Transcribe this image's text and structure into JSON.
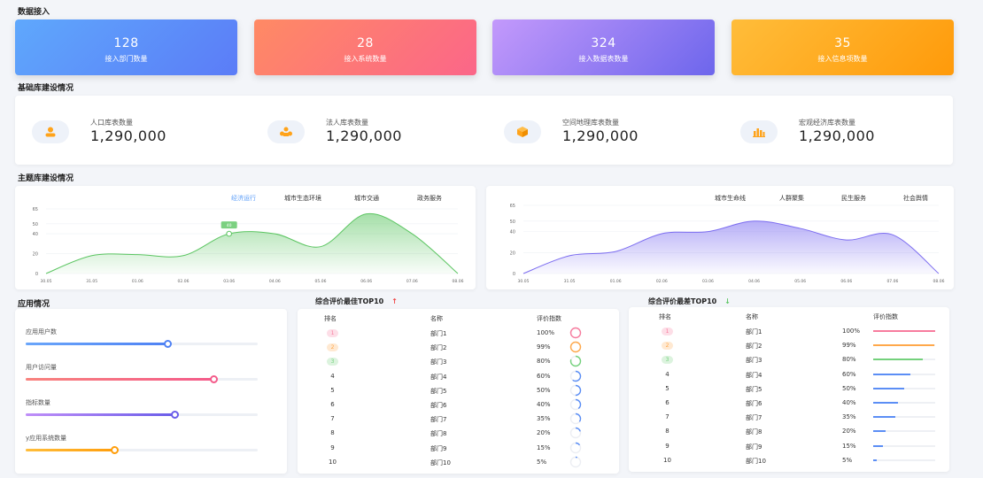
{
  "sections": {
    "data_access": "数据接入",
    "base_lib": "基础库建设情况",
    "theme_lib": "主题库建设情况",
    "app": "应用情况"
  },
  "kpis": [
    {
      "value": "128",
      "label": "接入部门数量",
      "from": "#5fa8fc",
      "to": "#5b7cf7"
    },
    {
      "value": "28",
      "label": "接入系统数量",
      "from": "#ff8a64",
      "to": "#fb6689"
    },
    {
      "value": "324",
      "label": "接入数据表数量",
      "from": "#c399fb",
      "to": "#6d66ec"
    },
    {
      "value": "35",
      "label": "接入信息项数量",
      "from": "#ffbd3a",
      "to": "#ff9a0a"
    }
  ],
  "base": [
    {
      "label": "人口库表数量",
      "value": "1,290,000",
      "icon": "person-icon"
    },
    {
      "label": "法人库表数量",
      "value": "1,290,000",
      "icon": "group-icon"
    },
    {
      "label": "空间地理库表数量",
      "value": "1,290,000",
      "icon": "cube-icon"
    },
    {
      "label": "宏观经济库表数量",
      "value": "1,290,000",
      "icon": "bar-chart-icon"
    }
  ],
  "left_tabs": [
    "经济运行",
    "城市生态环境",
    "城市交通",
    "政务服务"
  ],
  "right_tabs": [
    "城市生命线",
    "人群聚集",
    "民生服务",
    "社会舆情"
  ],
  "chart_data": [
    {
      "type": "area",
      "x": [
        "30.05",
        "31.05",
        "01.06",
        "02.06",
        "03.06",
        "04.06",
        "05.06",
        "06.06",
        "07.06",
        "08.06"
      ],
      "values": [
        0,
        18,
        19,
        18,
        40,
        40,
        27,
        60,
        40,
        0
      ],
      "ylim": [
        0,
        65
      ],
      "yticks": [
        0,
        20,
        40,
        50,
        65
      ],
      "color": "#5bc561",
      "tooltip_value": "40",
      "tooltip_index": 4
    },
    {
      "type": "area",
      "x": [
        "30.05",
        "31.05",
        "01.06",
        "02.06",
        "03.06",
        "04.06",
        "05.06",
        "06.06",
        "07.06",
        "08.06"
      ],
      "values": [
        0,
        17,
        21,
        38,
        40,
        50,
        43,
        32,
        37,
        0
      ],
      "ylim": [
        0,
        65
      ],
      "yticks": [
        0,
        20,
        40,
        50,
        65
      ],
      "color": "#7b6cf0"
    }
  ],
  "apps": [
    {
      "label": "应用用户数",
      "value": 0.61,
      "from": "#6aa6fa",
      "to": "#4f82f4",
      "knob": "#4f82f4"
    },
    {
      "label": "用户访问量",
      "value": 0.81,
      "from": "#f8837e",
      "to": "#f45b8a",
      "knob": "#f45b8a"
    },
    {
      "label": "指标数量",
      "value": 0.64,
      "from": "#c08ff8",
      "to": "#6a5de9",
      "knob": "#6a5de9"
    },
    {
      "label": "y应用系统数量",
      "value": 0.38,
      "from": "#ffbe3c",
      "to": "#ff9e0c",
      "knob": "#ff9e0c"
    }
  ],
  "best": {
    "title": "综合评价最佳TOP10",
    "arrow": "↑",
    "headers": [
      "排名",
      "名称",
      "评价指数"
    ],
    "rows": [
      {
        "rank": "1",
        "name": "部门1",
        "score": "100%",
        "pct": 1.0
      },
      {
        "rank": "2",
        "name": "部门2",
        "score": "99%",
        "pct": 0.99
      },
      {
        "rank": "3",
        "name": "部门3",
        "score": "80%",
        "pct": 0.8
      },
      {
        "rank": "4",
        "name": "部门4",
        "score": "60%",
        "pct": 0.6
      },
      {
        "rank": "5",
        "name": "部门5",
        "score": "50%",
        "pct": 0.5
      },
      {
        "rank": "6",
        "name": "部门6",
        "score": "40%",
        "pct": 0.4
      },
      {
        "rank": "7",
        "name": "部门7",
        "score": "35%",
        "pct": 0.35
      },
      {
        "rank": "8",
        "name": "部门8",
        "score": "20%",
        "pct": 0.2
      },
      {
        "rank": "9",
        "name": "部门9",
        "score": "15%",
        "pct": 0.15
      },
      {
        "rank": "10",
        "name": "部门10",
        "score": "5%",
        "pct": 0.05
      }
    ]
  },
  "worst": {
    "title": "综合评价最差TOP10",
    "arrow": "↓",
    "headers": [
      "排名",
      "名称",
      "评价指数"
    ],
    "rows": [
      {
        "rank": "1",
        "name": "部门1",
        "score": "100%",
        "pct": 1.0
      },
      {
        "rank": "2",
        "name": "部门2",
        "score": "99%",
        "pct": 0.99
      },
      {
        "rank": "3",
        "name": "部门3",
        "score": "80%",
        "pct": 0.8
      },
      {
        "rank": "4",
        "name": "部门4",
        "score": "60%",
        "pct": 0.6
      },
      {
        "rank": "5",
        "name": "部门5",
        "score": "50%",
        "pct": 0.5
      },
      {
        "rank": "6",
        "name": "部门6",
        "score": "40%",
        "pct": 0.4
      },
      {
        "rank": "7",
        "name": "部门7",
        "score": "35%",
        "pct": 0.35
      },
      {
        "rank": "8",
        "name": "部门8",
        "score": "20%",
        "pct": 0.2
      },
      {
        "rank": "9",
        "name": "部门9",
        "score": "15%",
        "pct": 0.15
      },
      {
        "rank": "10",
        "name": "部门10",
        "score": "5%",
        "pct": 0.05
      }
    ]
  },
  "rank_colors": [
    "#f77c9e",
    "#ffa84a",
    "#74d17c",
    "#5b8ef5"
  ]
}
